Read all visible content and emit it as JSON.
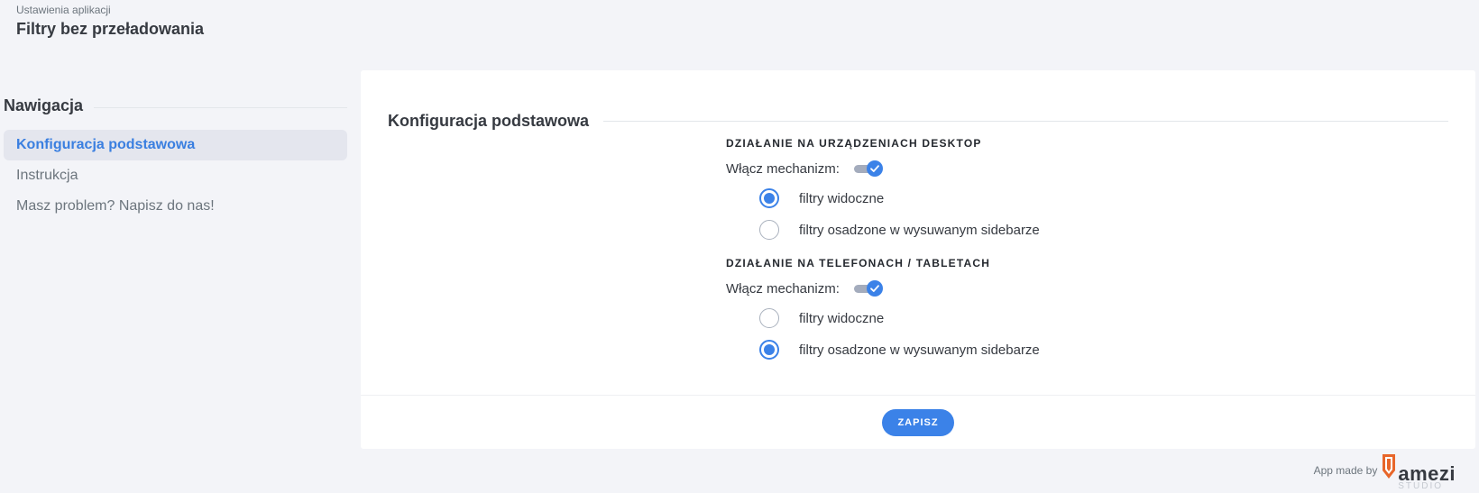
{
  "header": {
    "breadcrumb": "Ustawienia aplikacji",
    "title": "Filtry bez przeładowania"
  },
  "sidebar": {
    "heading": "Nawigacja",
    "items": [
      {
        "label": "Konfiguracja podstawowa",
        "active": true
      },
      {
        "label": "Instrukcja",
        "active": false
      },
      {
        "label": "Masz problem? Napisz do nas!",
        "active": false
      }
    ]
  },
  "main": {
    "section_title": "Konfiguracja podstawowa",
    "groups": [
      {
        "title": "DZIAŁANIE NA URZĄDZENIACH DESKTOP",
        "switch_label": "Włącz mechanizm:",
        "switch_on": true,
        "options": [
          {
            "label": "filtry widoczne",
            "checked": true
          },
          {
            "label": "filtry osadzone w wysuwanym sidebarze",
            "checked": false
          }
        ]
      },
      {
        "title": "DZIAŁANIE NA TELEFONACH / TABLETACH",
        "switch_label": "Włącz mechanizm:",
        "switch_on": true,
        "options": [
          {
            "label": "filtry widoczne",
            "checked": false
          },
          {
            "label": "filtry osadzone w wysuwanym sidebarze",
            "checked": true
          }
        ]
      }
    ],
    "save_label": "ZAPISZ"
  },
  "footer": {
    "credit": "App made by",
    "brand_name": "amezi",
    "brand_sub": "STUDIO"
  },
  "colors": {
    "accent": "#3b82e8",
    "background": "#f3f4f8",
    "panel": "#ffffff",
    "brand_orange": "#e8662a"
  },
  "icons": {
    "switch_knob": "check-icon",
    "brand_mark": "pencil-icon"
  }
}
